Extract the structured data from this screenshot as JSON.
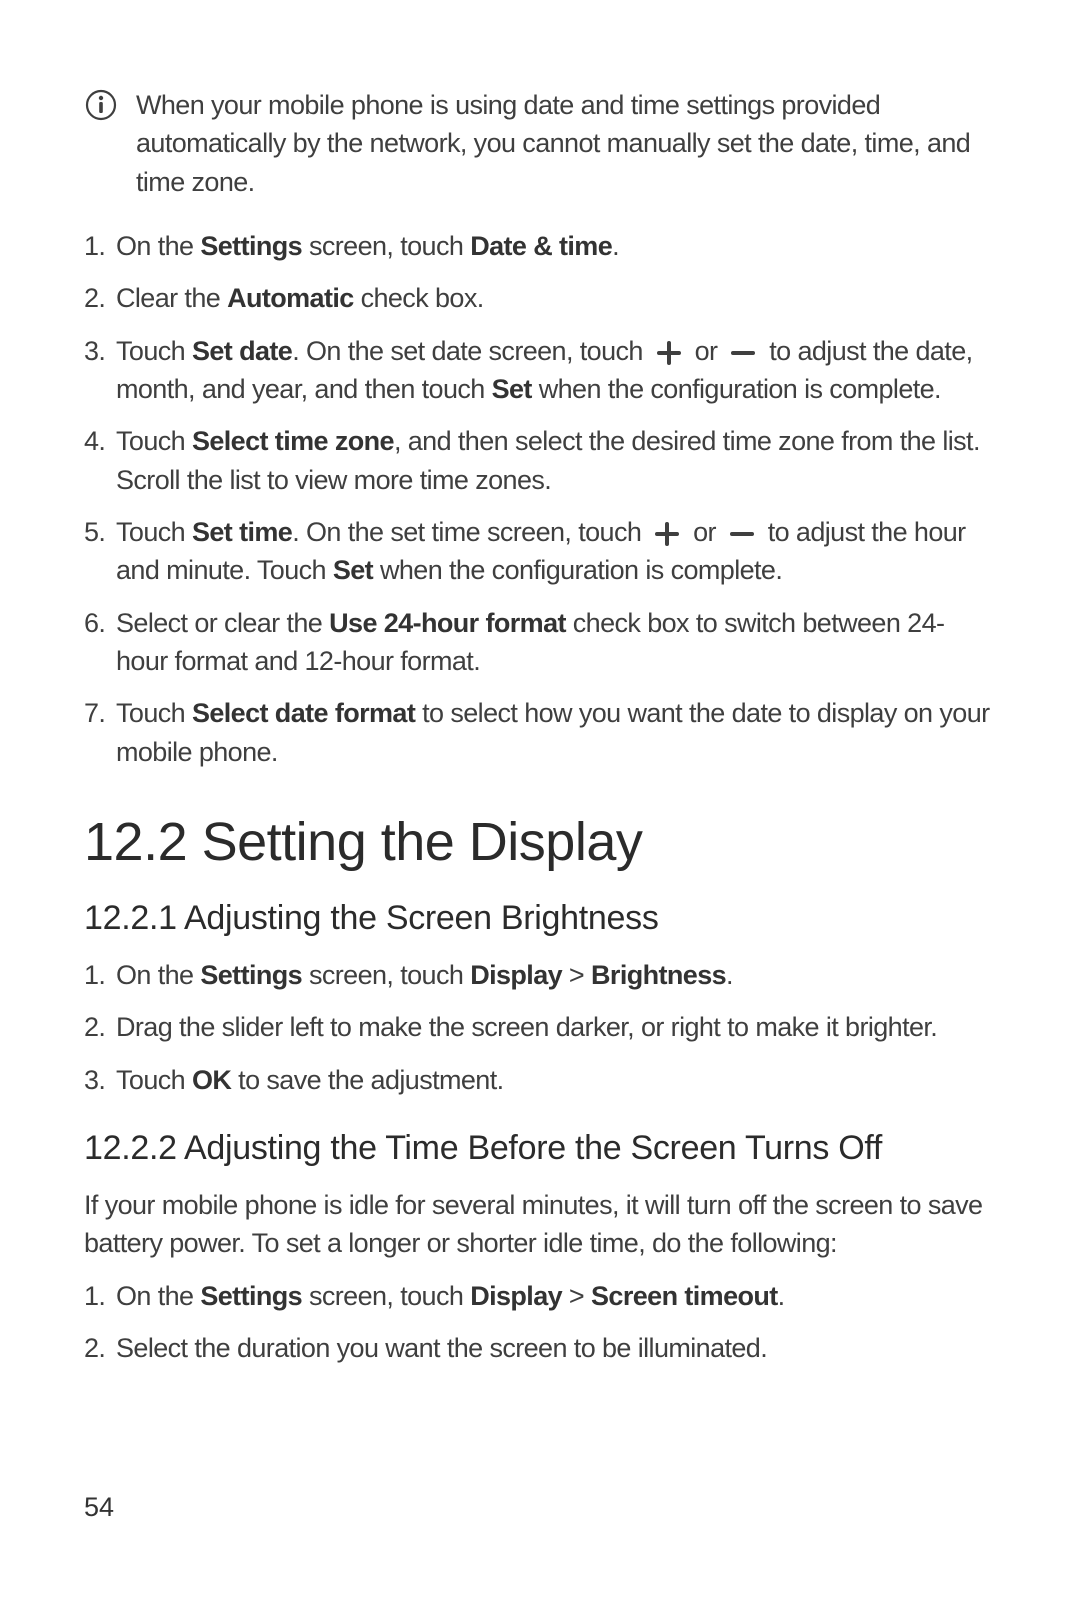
{
  "note": {
    "text_a": "When your mobile phone is using date and time settings provided automatically by the network, you cannot manually set the date, time, and time zone."
  },
  "dt_steps": {
    "s1": {
      "num": "1.",
      "a": "On the ",
      "b1": "Settings",
      "c": " screen, touch ",
      "b2": "Date & time",
      "d": "."
    },
    "s2": {
      "num": "2.",
      "a": "Clear the ",
      "b1": "Automatic",
      "c": " check box."
    },
    "s3": {
      "num": "3.",
      "a": "Touch ",
      "b1": "Set date",
      "c": ". On the set date screen, touch ",
      "or": " or ",
      "d": " to adjust the date, month, and year, and then touch ",
      "b2": "Set",
      "e": " when the configuration is complete."
    },
    "s4": {
      "num": "4.",
      "a": "Touch ",
      "b1": "Select time zone",
      "c": ", and then select the desired time zone from the list. Scroll the list to view more time zones."
    },
    "s5": {
      "num": "5.",
      "a": "Touch ",
      "b1": "Set time",
      "c": ". On the set time screen, touch ",
      "or": " or ",
      "d": " to adjust the hour and minute. Touch ",
      "b2": "Set",
      "e": " when the configuration is complete."
    },
    "s6": {
      "num": "6.",
      "a": "Select or clear the ",
      "b1": "Use 24-hour format",
      "c": " check box to switch between 24-hour format and 12-hour format."
    },
    "s7": {
      "num": "7.",
      "a": "Touch ",
      "b1": "Select date format",
      "c": " to select how you want the date to display on your mobile phone."
    }
  },
  "section12_2": {
    "title": "12.2  Setting the Display"
  },
  "sub12_2_1": {
    "title": "12.2.1  Adjusting the Screen Brightness",
    "s1": {
      "num": "1.",
      "a": "On the ",
      "b1": "Settings",
      "c": " screen, touch ",
      "b2": "Display",
      "sep": " > ",
      "b3": "Brightness",
      "d": "."
    },
    "s2": {
      "num": "2.",
      "a": "Drag the slider left to make the screen darker, or right to make it brighter."
    },
    "s3": {
      "num": "3.",
      "a": "Touch ",
      "b1": "OK",
      "c": " to save the adjustment."
    }
  },
  "sub12_2_2": {
    "title": "12.2.2  Adjusting the Time Before the Screen Turns Off",
    "intro": "If your mobile phone is idle for several minutes, it will turn off the screen to save battery power. To set a longer or shorter idle time, do the following:",
    "s1": {
      "num": "1.",
      "a": "On the ",
      "b1": "Settings",
      "c": " screen, touch ",
      "b2": "Display",
      "sep": " > ",
      "b3": "Screen timeout",
      "d": "."
    },
    "s2": {
      "num": "2.",
      "a": "Select the duration you want the screen to be illuminated."
    }
  },
  "page_number": "54"
}
